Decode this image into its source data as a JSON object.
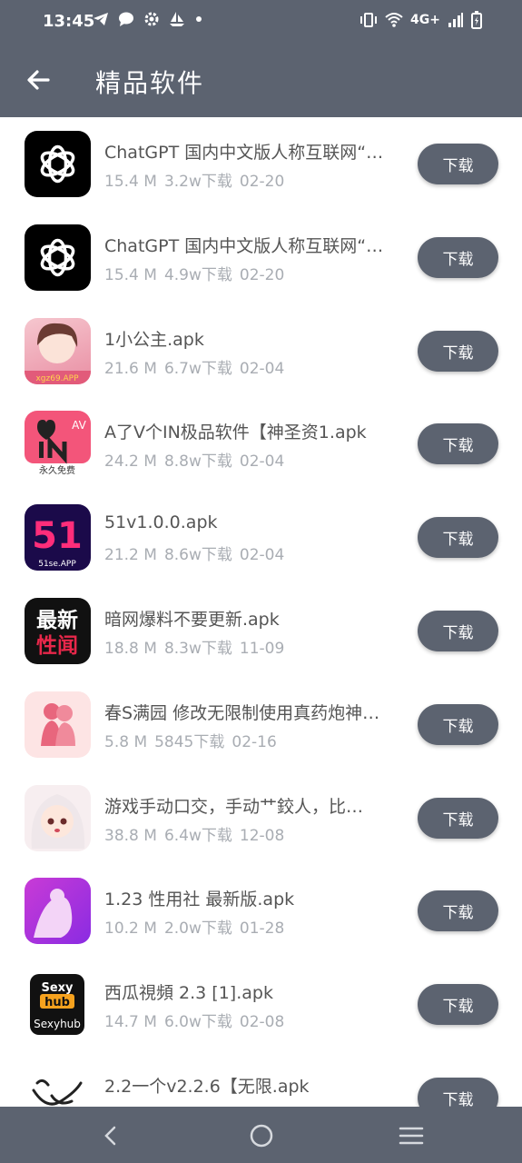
{
  "status_bar": {
    "time": "13:45",
    "network": "4G+"
  },
  "app_bar": {
    "title": "精品软件"
  },
  "apps": [
    {
      "name": "ChatGPT 国内中文版人称互联网“…",
      "size": "15.4 M",
      "downloads": "3.2w下载",
      "date": "02-20",
      "button": "下载",
      "icon": "chatgpt-logo"
    },
    {
      "name": "ChatGPT 国内中文版人称互联网“…",
      "size": "15.4 M",
      "downloads": "4.9w下载",
      "date": "02-20",
      "button": "下载",
      "icon": "chatgpt-logo"
    },
    {
      "name": "1小公主.apk",
      "size": "21.6 M",
      "downloads": "6.7w下载",
      "date": "02-04",
      "button": "下载",
      "icon": "anime-girl-pink"
    },
    {
      "name": "A了V个IN极品软件【神圣资1.apk",
      "size": "24.2 M",
      "downloads": "8.8w下载",
      "date": "02-04",
      "button": "下载",
      "icon": "avin-logo",
      "icon_text": "AV",
      "icon_subtext": "永久免费"
    },
    {
      "name": "51v1.0.0.apk",
      "size": "21.2 M",
      "downloads": "8.6w下载",
      "date": "02-04",
      "button": "下载",
      "icon": "51-logo",
      "icon_text": "51",
      "icon_subtext": "51se.APP"
    },
    {
      "name": "暗网爆料不要更新.apk",
      "size": "18.8 M",
      "downloads": "8.3w下载",
      "date": "11-09",
      "button": "下载",
      "icon": "newest-news-logo",
      "icon_text1": "最新",
      "icon_text2": "性闻"
    },
    {
      "name": "春S满园 修改无限制使用真药炮神…",
      "size": "5.8 M",
      "downloads": "5845下载",
      "date": "02-16",
      "button": "下载",
      "icon": "couple-silhouette"
    },
    {
      "name": "游戏手动口交，手动艹鉸人，比…",
      "size": "38.8 M",
      "downloads": "6.4w下载",
      "date": "12-08",
      "button": "下载",
      "icon": "anime-girl-white-hair"
    },
    {
      "name": "1.23 性用社 最新版.apk",
      "size": "10.2 M",
      "downloads": "2.0w下载",
      "date": "01-28",
      "button": "下载",
      "icon": "purple-silhouette"
    },
    {
      "name": "西瓜視頻 2.3 [1].apk",
      "size": "14.7 M",
      "downloads": "6.0w下载",
      "date": "02-08",
      "button": "下载",
      "icon": "sexyhub-logo",
      "icon_text1": "Sexy",
      "icon_text2": "hub",
      "icon_text3": "Sexyhub"
    },
    {
      "name": "2.2一个v2.2.6【无限.apk",
      "size": "",
      "downloads": "下载",
      "date": "",
      "button": "下载",
      "icon": "line-art-logo"
    }
  ],
  "colors": {
    "bar": "#5c6370",
    "meta_text": "#a9adb3",
    "name_text": "#555555"
  }
}
